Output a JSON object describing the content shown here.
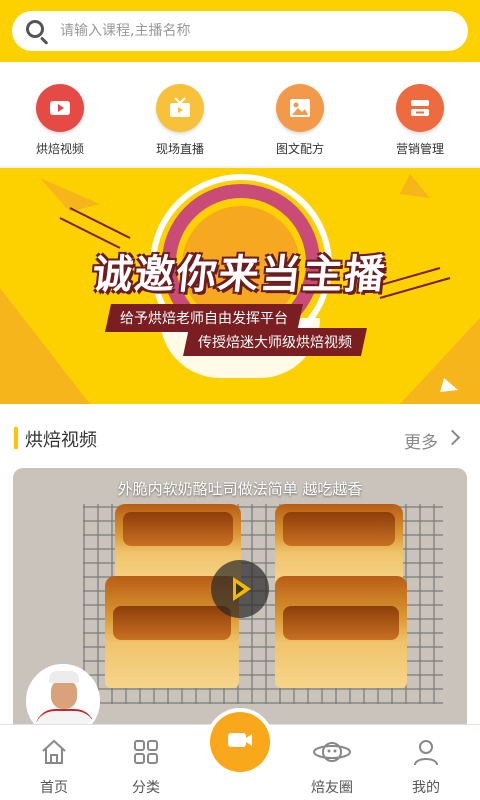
{
  "search": {
    "placeholder": "请输入课程,主播名称"
  },
  "quicknav": [
    {
      "label": "烘焙视频",
      "color": "#e64a45",
      "icon": "video-camera-icon"
    },
    {
      "label": "现场直播",
      "color": "#f7c23a",
      "icon": "tv-icon"
    },
    {
      "label": "图文配方",
      "color": "#f39a4a",
      "icon": "image-icon"
    },
    {
      "label": "营销管理",
      "color": "#ee6b3f",
      "icon": "management-icon"
    }
  ],
  "banner": {
    "title": "诚邀你来当主播",
    "line1": "给予烘焙老师自由发挥平台",
    "line2": "传授焙迷大师级烘焙视频",
    "bg": "#fdd100",
    "accent": "#7a1e22"
  },
  "section": {
    "title": "烘焙视频",
    "more": "更多"
  },
  "video": {
    "title": "外脆内软奶酪吐司做法简单 越吃越香",
    "play_color": "#f5b800"
  },
  "tabs": [
    {
      "label": "首页",
      "icon": "home-icon"
    },
    {
      "label": "分类",
      "icon": "grid-icon"
    },
    {
      "label": "",
      "icon": "video-camera-icon"
    },
    {
      "label": "焙友圈",
      "icon": "planet-icon"
    },
    {
      "label": "我的",
      "icon": "user-icon"
    }
  ],
  "theme": {
    "primary": "#fdd100",
    "center_button": "#f9a81b"
  }
}
